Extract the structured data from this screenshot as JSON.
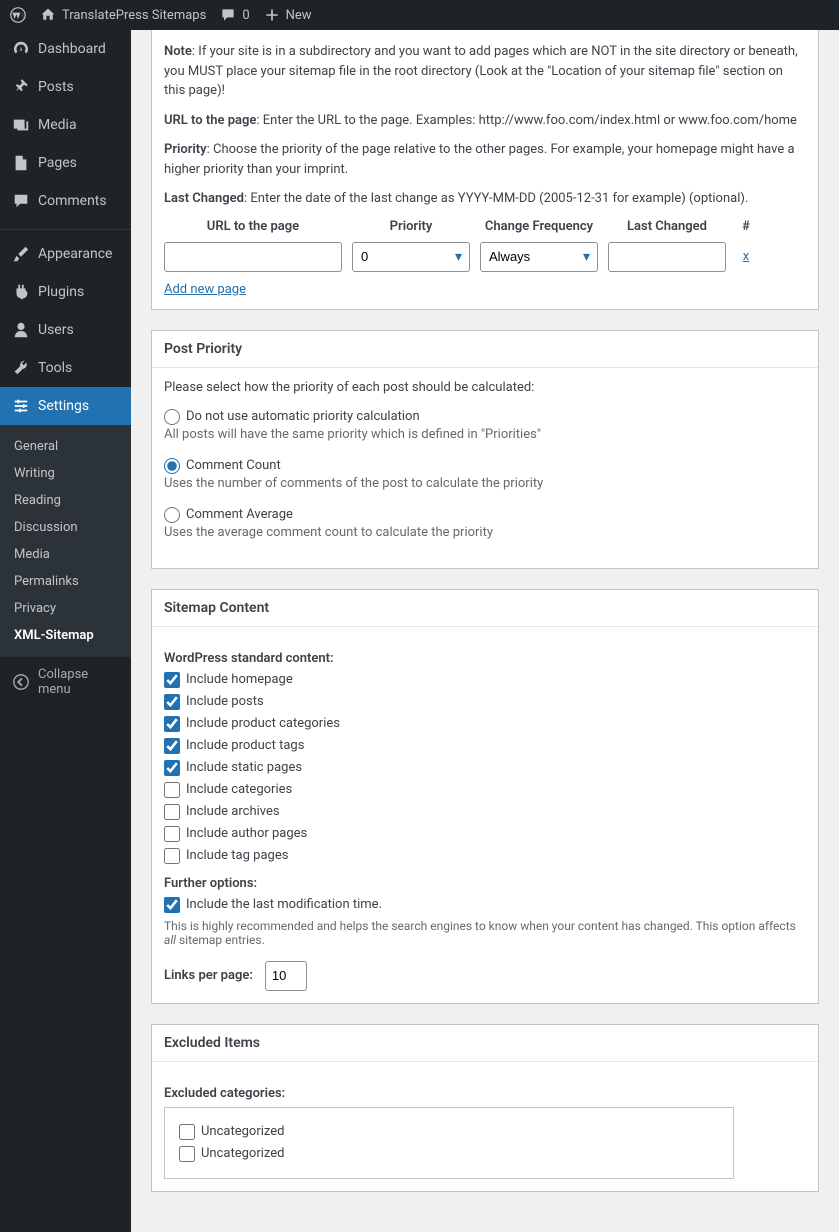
{
  "toolbar": {
    "site_name": "TranslatePress Sitemaps",
    "comments_count": "0",
    "new_label": "New"
  },
  "sidebar": {
    "items": [
      {
        "icon": "dashboard",
        "label": "Dashboard"
      },
      {
        "icon": "pin",
        "label": "Posts"
      },
      {
        "icon": "media",
        "label": "Media"
      },
      {
        "icon": "page",
        "label": "Pages"
      },
      {
        "icon": "comment",
        "label": "Comments"
      },
      {
        "icon": "brush",
        "label": "Appearance"
      },
      {
        "icon": "plugin",
        "label": "Plugins"
      },
      {
        "icon": "user",
        "label": "Users"
      },
      {
        "icon": "wrench",
        "label": "Tools"
      },
      {
        "icon": "settings",
        "label": "Settings",
        "active": true
      }
    ],
    "submenu": [
      "General",
      "Writing",
      "Reading",
      "Discussion",
      "Media",
      "Permalinks",
      "Privacy",
      "XML-Sitemap"
    ],
    "submenu_current": "XML-Sitemap",
    "collapse_label": "Collapse menu"
  },
  "additional_pages": {
    "help": {
      "note_label": "Note",
      "note_text": ": If your site is in a subdirectory and you want to add pages which are NOT in the site directory or beneath, you MUST place your sitemap file in the root directory (Look at the \"Location of your sitemap file\" section on this page)!",
      "url_label": "URL to the page",
      "url_text": ": Enter the URL to the page. Examples: http://www.foo.com/index.html or www.foo.com/home",
      "priority_label": "Priority",
      "priority_text": ": Choose the priority of the page relative to the other pages. For example, your homepage might have a higher priority than your imprint.",
      "changed_label": "Last Changed",
      "changed_text": ": Enter the date of the last change as YYYY-MM-DD (2005-12-31 for example) (optional)."
    },
    "headers": {
      "url": "URL to the page",
      "priority": "Priority",
      "freq": "Change Frequency",
      "changed": "Last Changed",
      "hash": "#"
    },
    "row": {
      "priority": "0",
      "freq": "Always"
    },
    "delete": "x",
    "add_new": "Add new page"
  },
  "post_priority": {
    "title": "Post Priority",
    "intro": "Please select how the priority of each post should be calculated:",
    "options": [
      {
        "label": "Do not use automatic priority calculation",
        "desc": "All posts will have the same priority which is defined in \"Priorities\""
      },
      {
        "label": "Comment Count",
        "desc": "Uses the number of comments of the post to calculate the priority"
      },
      {
        "label": "Comment Average",
        "desc": "Uses the average comment count to calculate the priority"
      }
    ],
    "selected": 1
  },
  "sitemap_content": {
    "title": "Sitemap Content",
    "standard_header": "WordPress standard content:",
    "items": [
      {
        "label": "Include homepage",
        "checked": true
      },
      {
        "label": "Include posts",
        "checked": true
      },
      {
        "label": "Include product categories",
        "checked": true
      },
      {
        "label": "Include product tags",
        "checked": true
      },
      {
        "label": "Include static pages",
        "checked": true
      },
      {
        "label": "Include categories",
        "checked": false
      },
      {
        "label": "Include archives",
        "checked": false
      },
      {
        "label": "Include author pages",
        "checked": false
      },
      {
        "label": "Include tag pages",
        "checked": false
      }
    ],
    "further_header": "Further options:",
    "modtime": {
      "label": "Include the last modification time.",
      "checked": true
    },
    "modtime_hint_pre": "This is highly recommended and helps the search engines to know when your content has changed. This option affects ",
    "modtime_hint_em": "all",
    "modtime_hint_post": " sitemap entries.",
    "links_label": "Links per page:",
    "links_value": "10"
  },
  "excluded": {
    "title": "Excluded Items",
    "cats_header": "Excluded categories:",
    "cats": [
      {
        "label": "Uncategorized",
        "checked": false
      },
      {
        "label": "Uncategorized",
        "checked": false
      }
    ]
  }
}
